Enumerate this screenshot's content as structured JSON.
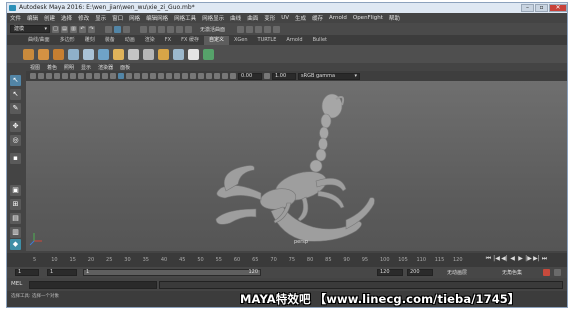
{
  "window": {
    "title": "Autodesk Maya 2016: E:\\wen_jian\\wen_wu\\xie_zi_Guo.mb*"
  },
  "menubar": [
    "文件",
    "编辑",
    "创建",
    "选择",
    "修改",
    "显示",
    "窗口",
    "网格",
    "编辑网格",
    "网格工具",
    "网格显示",
    "曲线",
    "曲面",
    "变形",
    "UV",
    "生成",
    "缓存",
    "Arnold",
    "OpenFlight",
    "帮助"
  ],
  "status_line": {
    "menuset": "建模",
    "live_surface": "无激活曲面"
  },
  "shelf_tabs": [
    "曲线/曲面",
    "多边形",
    "雕刻",
    "装备",
    "动画",
    "渲染",
    "FX",
    "FX 缓存",
    "自定义",
    "XGen",
    "TURTLE",
    "Arnold",
    "Bullet"
  ],
  "shelf_active_tab": "自定义",
  "panel_menu": [
    "视图",
    "着色",
    "照明",
    "显示",
    "渲染器",
    "面板"
  ],
  "panel_toolbar": {
    "near_value": "0.00",
    "far_value": "1.00",
    "color_space": "sRGB gamma"
  },
  "viewport": {
    "object_label": "persp"
  },
  "timeline": {
    "ticks": [
      "5",
      "10",
      "15",
      "20",
      "25",
      "30",
      "35",
      "40",
      "45",
      "50",
      "55",
      "60",
      "65",
      "70",
      "75",
      "80",
      "85",
      "90",
      "95",
      "100",
      "105",
      "110",
      "115",
      "120"
    ]
  },
  "range": {
    "start": "1",
    "playback_start": "1",
    "slider_start": "1",
    "slider_end": "120",
    "playback_end": "120",
    "end": "200",
    "anim_layer": "无动画层",
    "char_set": "无角色集"
  },
  "cmdline": {
    "label": "MEL"
  },
  "help_line": "选择工具: 选择一个对象",
  "watermark": "MAYA特效吧 【www.linecg.com/tieba/1745】",
  "colors": {
    "ui_bg": "#444444",
    "viewport_top": "#6f6f6f",
    "viewport_bottom": "#555555",
    "accent": "#5285a6"
  }
}
